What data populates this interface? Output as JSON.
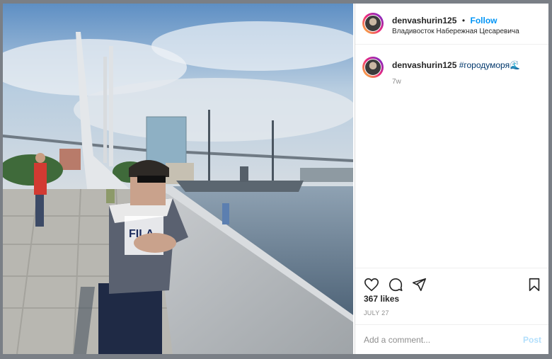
{
  "post": {
    "username": "denvashurin125",
    "separator": "•",
    "follow_label": "Follow",
    "location": "Владивосток Набережная Цесаревича",
    "caption_username": "denvashurin125",
    "caption_hashtag": "#городуморя",
    "caption_emoji": "🌊",
    "age": "7w",
    "likes": "367 likes",
    "date": "JULY 27",
    "comment_placeholder": "Add a comment...",
    "post_label": "Post"
  },
  "icons": [
    "heart-icon",
    "comment-icon",
    "share-icon",
    "bookmark-icon"
  ],
  "colors": {
    "accent": "#0095f6",
    "text": "#262626",
    "muted": "#8e8e8e"
  }
}
